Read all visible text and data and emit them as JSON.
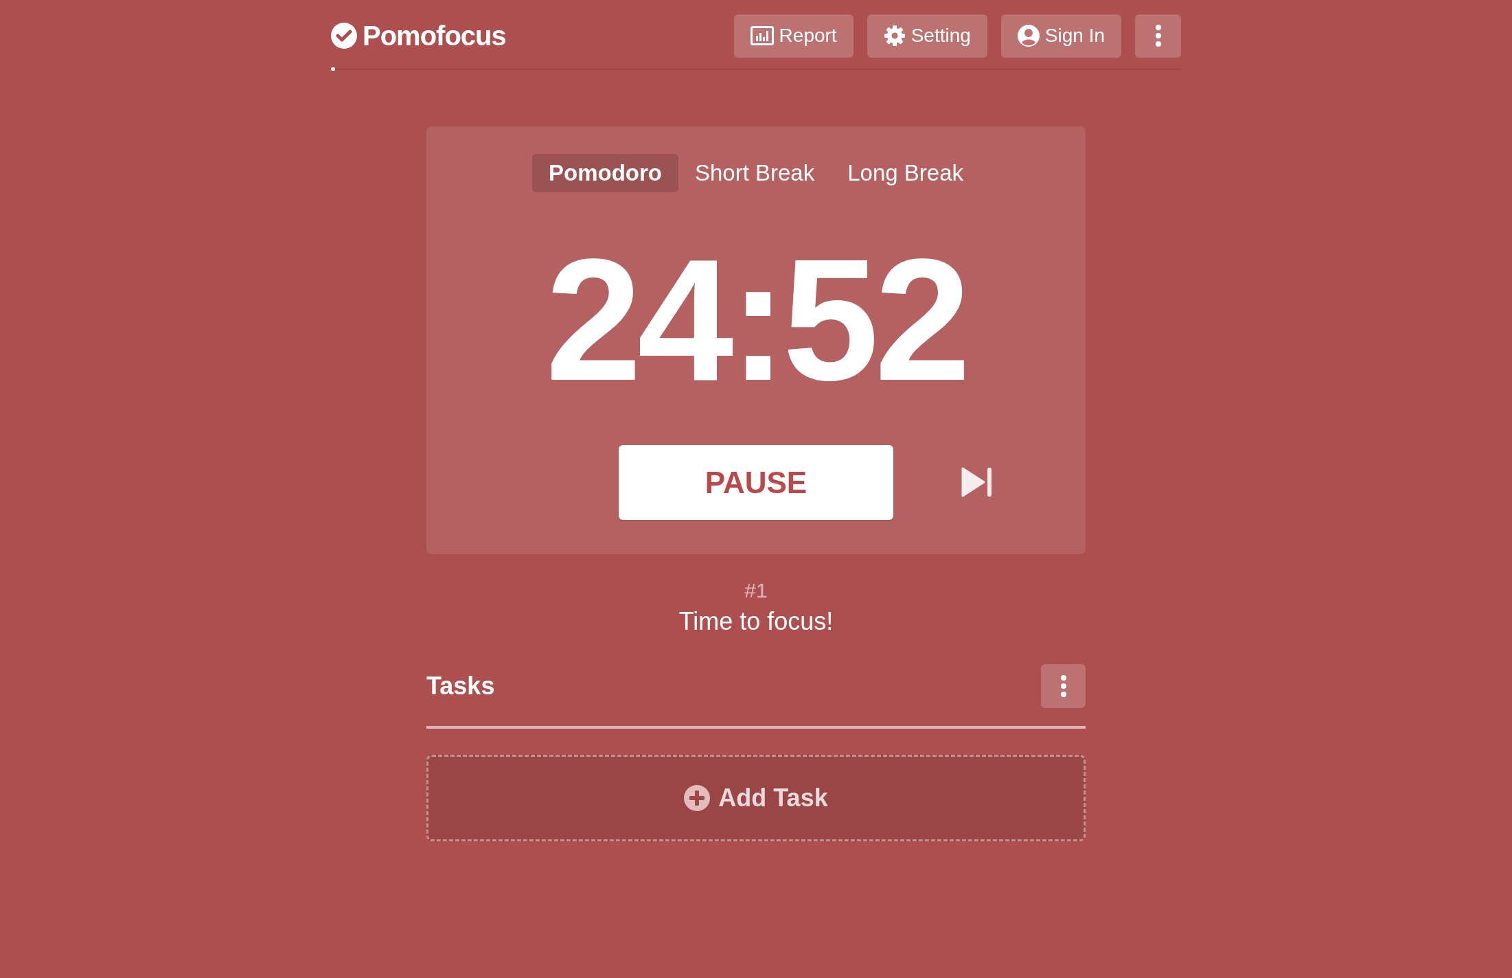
{
  "header": {
    "logo": "Pomofocus",
    "buttons": [
      {
        "kind": "report",
        "label": "Report"
      },
      {
        "kind": "setting",
        "label": "Setting"
      },
      {
        "kind": "signin",
        "label": "Sign In"
      },
      {
        "kind": "menu"
      }
    ]
  },
  "progress": {
    "level": 0.005
  },
  "timer": {
    "tabs": [
      {
        "label": "Pomodoro",
        "selected": true
      },
      {
        "label": "Short Break",
        "selected": false
      },
      {
        "label": "Long Break",
        "selected": false
      }
    ],
    "time": "24:52",
    "action": "PAUSE"
  },
  "session": {
    "count": "#1",
    "message": "Time to focus!"
  },
  "tasks": {
    "title": "Tasks",
    "add_label": "Add Task"
  }
}
